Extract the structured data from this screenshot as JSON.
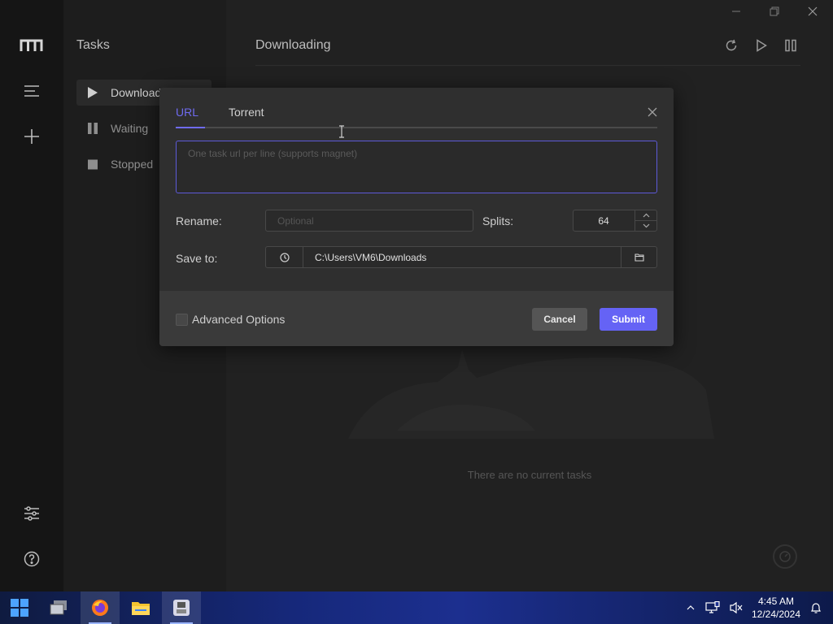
{
  "sidebar": {
    "title": "Tasks",
    "items": [
      {
        "label": "Downloading"
      },
      {
        "label": "Waiting"
      },
      {
        "label": "Stopped"
      }
    ]
  },
  "main": {
    "title": "Downloading",
    "empty_text": "There are no current tasks"
  },
  "dialog": {
    "tabs": [
      {
        "label": "URL"
      },
      {
        "label": "Torrent"
      }
    ],
    "url_placeholder": "One task url per line (supports magnet)",
    "rename_label": "Rename:",
    "rename_placeholder": "Optional",
    "splits_label": "Splits:",
    "splits_value": "64",
    "save_to_label": "Save to:",
    "save_path": "C:\\Users\\VM6\\Downloads",
    "advanced_label": "Advanced Options",
    "cancel_label": "Cancel",
    "submit_label": "Submit"
  },
  "taskbar": {
    "time": "4:45 AM",
    "date": "12/24/2024"
  },
  "colors": {
    "accent": "#6563f5",
    "background": "#212121",
    "dialog": "#2f2f2f"
  }
}
